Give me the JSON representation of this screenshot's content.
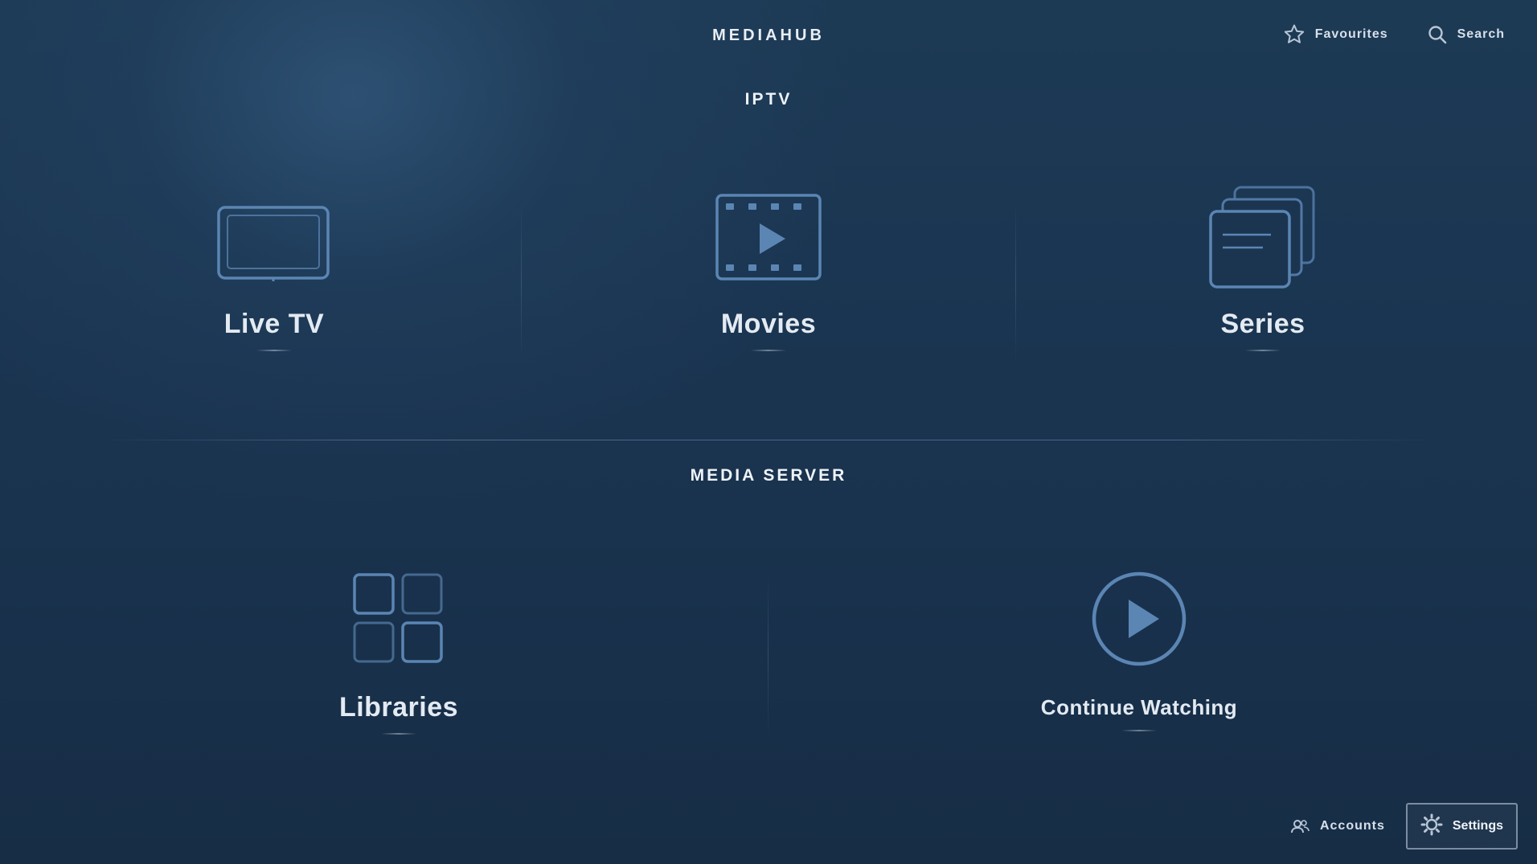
{
  "header": {
    "brand": "MEDIAHUB",
    "favourites_label": "Favourites",
    "search_label": "Search"
  },
  "iptv": {
    "title": "IPTV",
    "tiles": [
      {
        "label": "Live TV",
        "icon": "tv-icon"
      },
      {
        "label": "Movies",
        "icon": "film-play-icon"
      },
      {
        "label": "Series",
        "icon": "stacked-pages-icon"
      }
    ]
  },
  "media_server": {
    "title": "MEDIA SERVER",
    "tiles": [
      {
        "label": "Libraries",
        "icon": "grid-icon"
      },
      {
        "label": "Continue Watching",
        "icon": "play-circle-icon"
      }
    ]
  },
  "footer": {
    "accounts_label": "Accounts",
    "settings_label": "Settings"
  },
  "colors": {
    "icon_stroke": "#5b85b3",
    "background": "#1a3450"
  }
}
